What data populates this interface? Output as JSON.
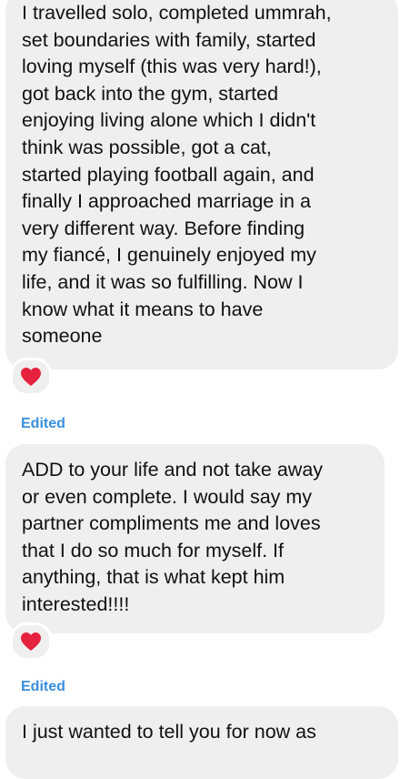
{
  "messages": [
    {
      "text": "I travelled solo, completed ummrah,\nset boundaries with family, started\nloving myself (this was very hard!),\ngot back into the gym, started\nenjoying living alone which I didn't\nthink was possible, got a cat,\nstarted playing football again, and\nfinally I approached marriage in a\nvery different way. Before finding\nmy fiancé, I genuinely enjoyed my\nlife, and it was so fulfilling. Now I\nknow what it means to have\nsomeone",
      "reaction": "red-heart"
    },
    {
      "edited_label": "Edited",
      "text": "ADD to your life and not take away\nor even complete. I would say my\npartner compliments me and loves\nthat I do so much for myself. If\nanything, that is what kept him\ninterested!!!!",
      "reaction": "red-heart"
    },
    {
      "edited_label": "Edited",
      "text": "I just wanted to tell you for now as"
    }
  ],
  "colors": {
    "bubble_bg": "#efefef",
    "text": "#111111",
    "edited": "#3a8fdc",
    "heart": "#e5213d"
  }
}
